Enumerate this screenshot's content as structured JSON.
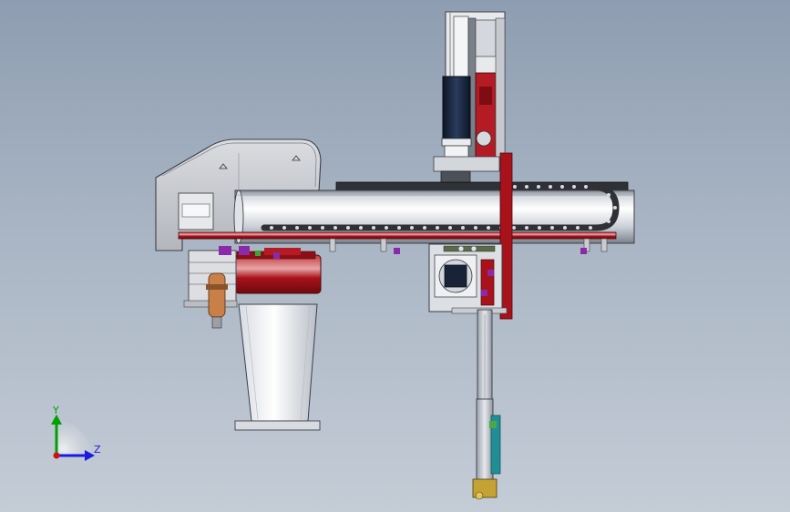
{
  "triad": {
    "y_label": "Y",
    "z_label": "Z",
    "y_color": "#00a000",
    "z_color": "#1a1ae0",
    "origin_color": "#d01010"
  },
  "colors": {
    "steel_light": "#eef0f4",
    "steel_mid": "#b4bac4",
    "steel_dark": "#6c737e",
    "housing": "#c5c7cc",
    "red_accent": "#a8121a",
    "chain": "#3b3d42",
    "motor_blue": "#1a2a44",
    "fastener_purple": "#8a2aa8",
    "teal_bracket": "#1f8f95"
  }
}
